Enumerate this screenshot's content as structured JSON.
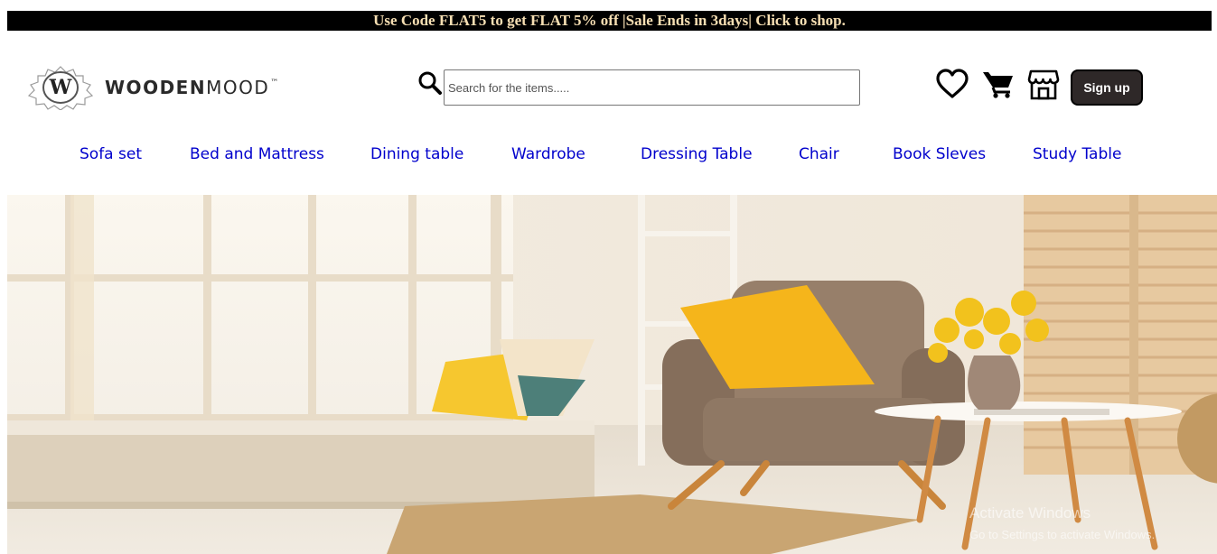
{
  "promo": {
    "text": "Use Code FLAT5 to get FLAT 5% off |Sale Ends in 3days| Click to shop."
  },
  "logo": {
    "letter": "W",
    "bold": "WOODEN",
    "light": "MOOD",
    "tm": "™"
  },
  "search": {
    "placeholder": "Search for the items.....",
    "value": "",
    "icon": "search-icon"
  },
  "header_icons": [
    {
      "name": "heart-icon",
      "label": "Wishlist"
    },
    {
      "name": "cart-icon",
      "label": "Cart"
    },
    {
      "name": "store-icon",
      "label": "Store"
    }
  ],
  "signup": {
    "label": "Sign up"
  },
  "nav": {
    "items": [
      {
        "label": "Sofa set"
      },
      {
        "label": "Bed and Mattress"
      },
      {
        "label": "Dining table"
      },
      {
        "label": "Wardrobe"
      },
      {
        "label": "Dressing Table"
      },
      {
        "label": "Chair"
      },
      {
        "label": "Book Sleves"
      },
      {
        "label": "Study Table"
      }
    ]
  },
  "watermark": {
    "line1": "Activate Windows",
    "line2": "Go to Settings to activate Windows."
  },
  "colors": {
    "promo_bg": "#000000",
    "promo_text": "#f7dfb3",
    "nav_link": "#0000cc",
    "signup_bg": "#2e2828"
  }
}
